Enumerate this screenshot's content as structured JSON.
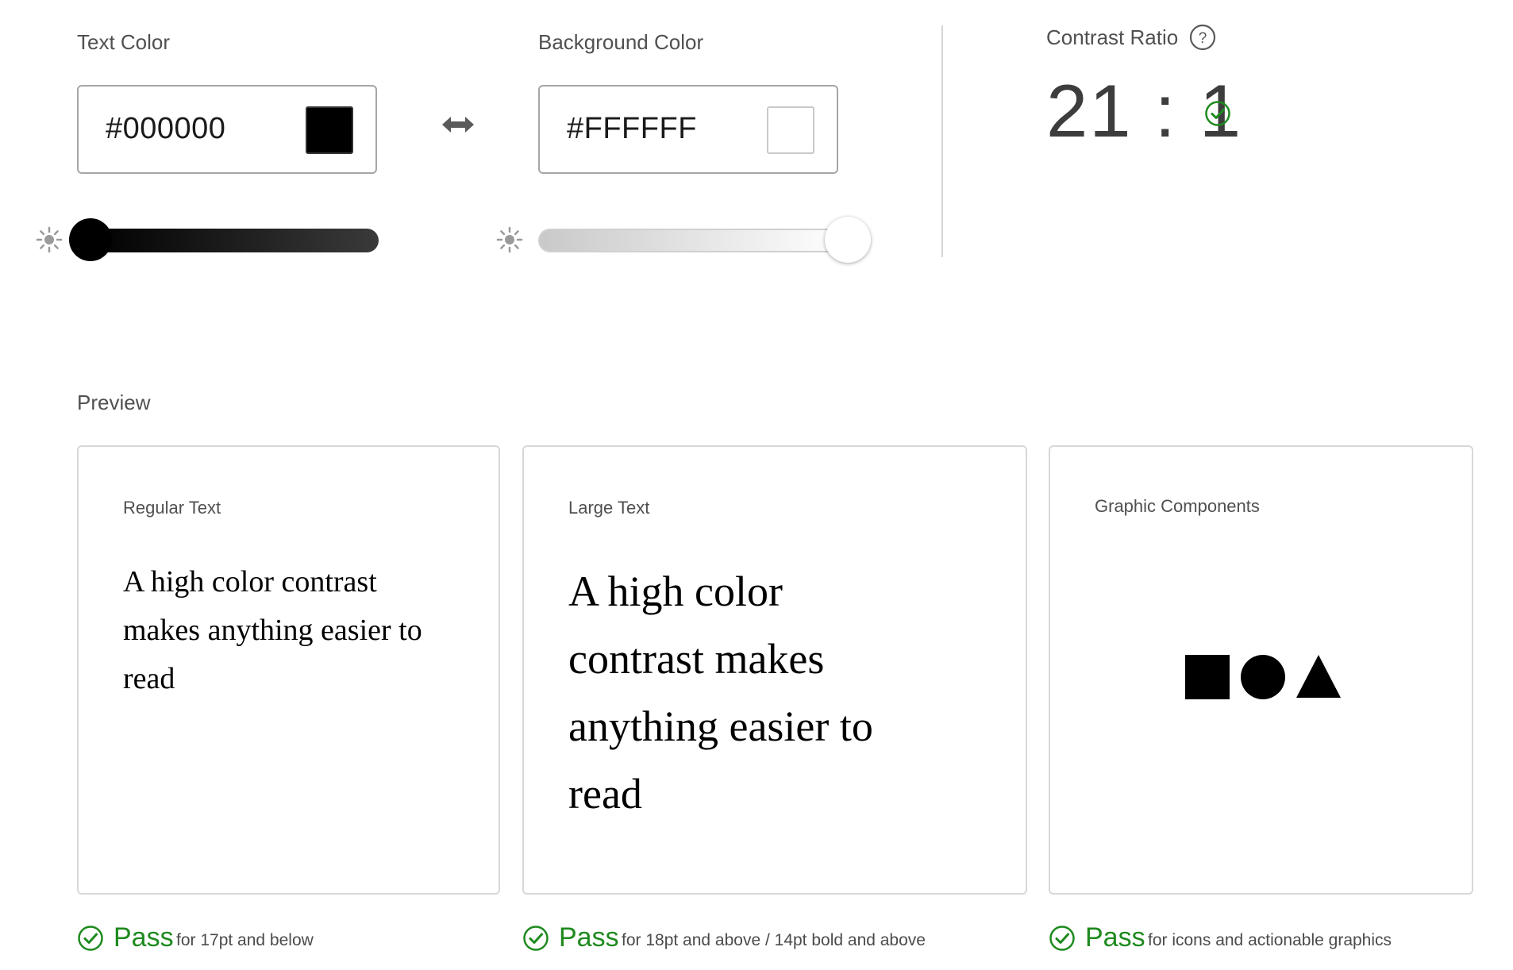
{
  "text_color": {
    "label": "Text Color",
    "hex": "#000000",
    "swatch_color": "#000000"
  },
  "background_color": {
    "label": "Background Color",
    "hex": "#FFFFFF",
    "swatch_color": "#FFFFFF"
  },
  "contrast": {
    "label": "Contrast Ratio",
    "value": "21 : 1"
  },
  "preview": {
    "label": "Preview",
    "cards": [
      {
        "title": "Regular Text",
        "sample": "A high color contrast makes anything easier to read"
      },
      {
        "title": "Large Text",
        "sample": "A high color contrast makes anything easier to read"
      },
      {
        "title": "Graphic Components",
        "shapes": [
          "square",
          "circle",
          "triangle"
        ]
      }
    ],
    "results": [
      {
        "status": "Pass",
        "desc": "for 17pt and below"
      },
      {
        "status": "Pass",
        "desc": "for 18pt and above / 14pt bold and above"
      },
      {
        "status": "Pass",
        "desc": "for icons and actionable graphics"
      }
    ]
  },
  "colors": {
    "pass": "#1e8a1e",
    "border": "#a6a6a6"
  }
}
